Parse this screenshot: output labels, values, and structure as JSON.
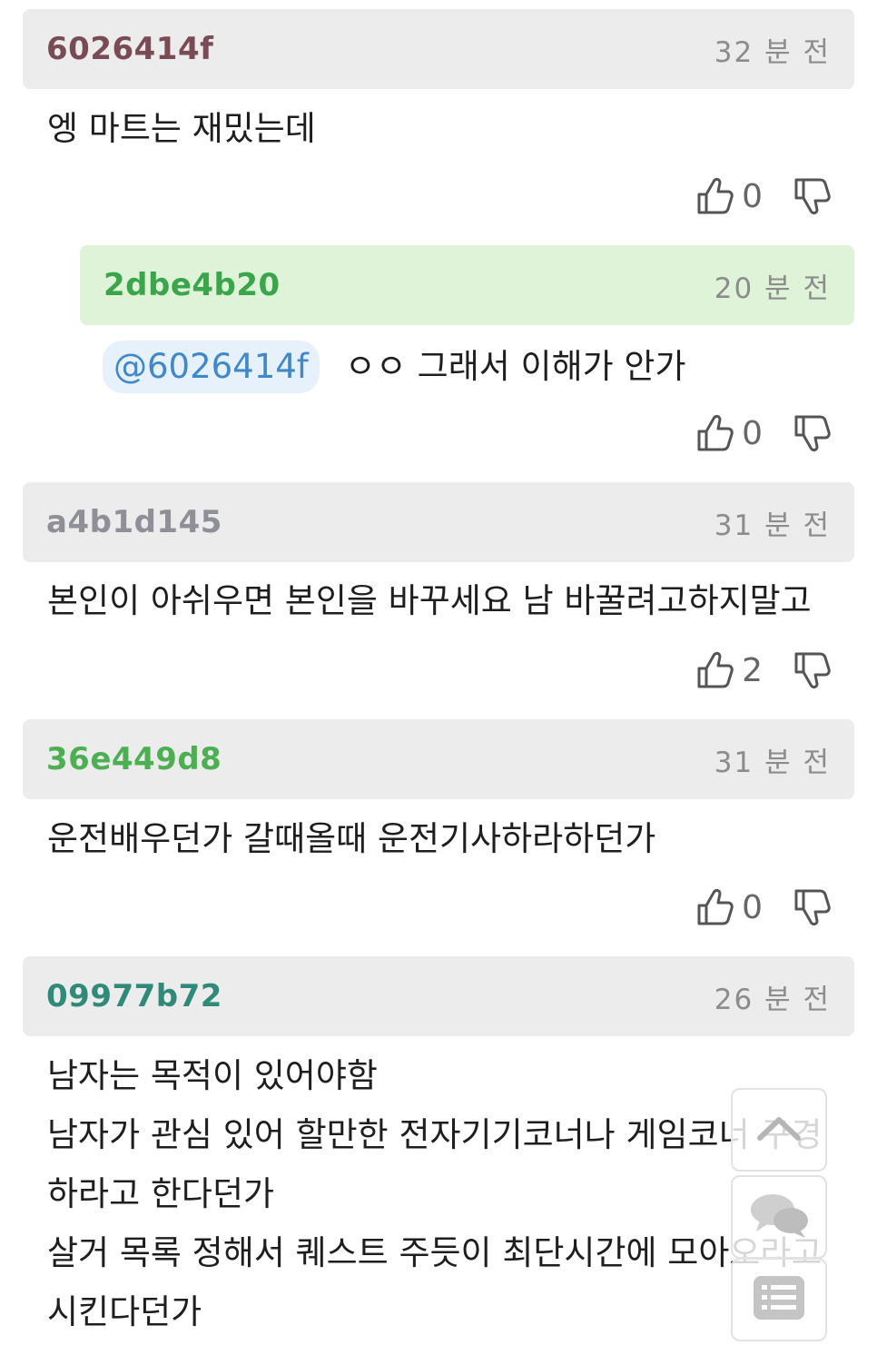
{
  "comments": [
    {
      "author": "6026414f",
      "author_color": "#7a4b55",
      "time": "32 분 전",
      "lines": [
        "엥 마트는 재밌는데"
      ],
      "likes": "0"
    },
    {
      "author": "2dbe4b20",
      "author_color": "#3aa54a",
      "time": "20 분 전",
      "mention": "@6026414f",
      "text": "ㅇㅇ 그래서 이해가 안가",
      "likes": "0"
    },
    {
      "author": "a4b1d145",
      "author_color": "#8f8f97",
      "time": "31 분 전",
      "lines": [
        "본인이 아쉬우면 본인을 바꾸세요 남 바꿀려고하지말고"
      ],
      "likes": "2"
    },
    {
      "author": "36e449d8",
      "author_color": "#4cb053",
      "time": "31 분 전",
      "lines": [
        "운전배우던가 갈때올때 운전기사하라하던가"
      ],
      "likes": "0"
    },
    {
      "author": "09977b72",
      "author_color": "#2f8a79",
      "time": "26 분 전",
      "lines": [
        "남자는 목적이 있어야함",
        "남자가 관심 있어 할만한 전자기기코너나 게임코너 구경",
        "하라고 한다던가",
        "살거 목록 정해서 퀘스트 주듯이 최단시간에 모아오라고",
        "시킨다던가"
      ]
    }
  ],
  "icons": {
    "like": "thumbs-up-icon",
    "dislike": "thumbs-down-icon",
    "scroll_top": "chevron-up-icon",
    "chat": "chat-bubbles-icon",
    "list": "list-icon"
  }
}
